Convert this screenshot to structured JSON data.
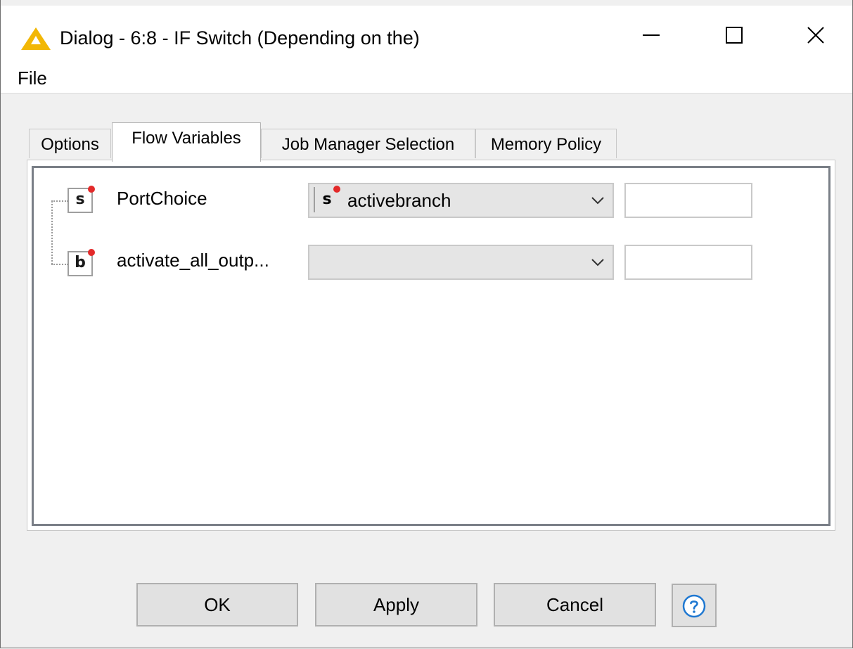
{
  "window": {
    "title": "Dialog - 6:8 - IF Switch (Depending on the)",
    "controls": {
      "close_glyph": "✕"
    }
  },
  "menubar": {
    "file": "File"
  },
  "tabs": [
    {
      "label": "Options",
      "active": false
    },
    {
      "label": "Flow Variables",
      "active": true
    },
    {
      "label": "Job Manager Selection",
      "active": false
    },
    {
      "label": "Memory Policy",
      "active": false
    }
  ],
  "flow_variables": [
    {
      "name": "PortChoice",
      "type_glyph": "s",
      "selected_variable": "activebranch",
      "selected_type_glyph": "s",
      "field_value": ""
    },
    {
      "name": "activate_all_outp...",
      "type_glyph": "b",
      "selected_variable": "",
      "field_value": ""
    }
  ],
  "buttons": {
    "ok": "OK",
    "apply": "Apply",
    "cancel": "Cancel"
  },
  "colors": {
    "accent_warning": "#f2b705",
    "dot": "#e32a2a",
    "help_blue": "#1f78d1"
  }
}
